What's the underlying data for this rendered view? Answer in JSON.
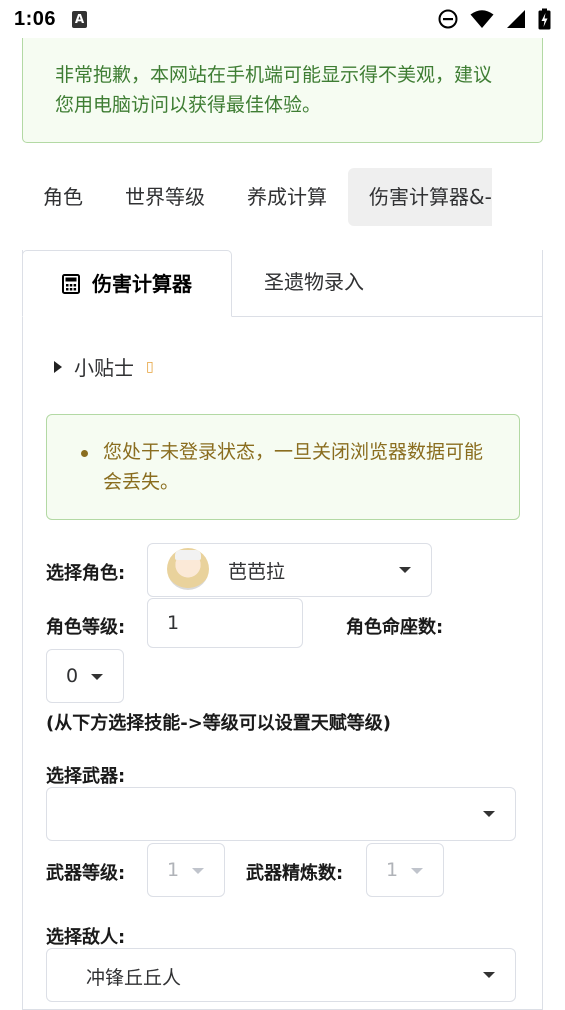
{
  "status_bar": {
    "time": "1:06",
    "app_icon_letter": "A",
    "icons": [
      "dnd-icon",
      "wifi-icon",
      "signal-icon",
      "battery-icon"
    ]
  },
  "notice": {
    "text": "非常抱歉，本网站在手机端可能显示得不美观，建议您用电脑访问以获得最佳体验。"
  },
  "nav_tabs": [
    {
      "label": "角色"
    },
    {
      "label": "世界等级"
    },
    {
      "label": "养成计算"
    },
    {
      "label": "伤害计算器&-"
    }
  ],
  "sub_tabs": {
    "damage_calc": "伤害计算器",
    "artifact_input": "圣遗物录入"
  },
  "tip": {
    "label": "小贴士",
    "emoji": "▯"
  },
  "alert": {
    "text": "您处于未登录状态，一旦关闭浏览器数据可能会丢失。"
  },
  "form": {
    "select_character_label": "选择角色:",
    "character_value": "芭芭拉",
    "character_level_label": "角色等级:",
    "character_level_value": "1",
    "constellation_label": "角色命座数:",
    "constellation_value": "0",
    "talent_hint": "(从下方选择技能->等级可以设置天赋等级)",
    "select_weapon_label": "选择武器:",
    "weapon_value": "",
    "weapon_level_label": "武器等级:",
    "weapon_level_value": "1",
    "refine_label": "武器精炼数:",
    "refine_value": "1",
    "select_enemy_label": "选择敌人:",
    "enemy_value": "冲锋丘丘人"
  },
  "colors": {
    "notice_bg": "#f6fcf2",
    "notice_border": "#b3d9a4",
    "notice_text": "#3e7d33",
    "alert_text": "#8a6d1f"
  }
}
